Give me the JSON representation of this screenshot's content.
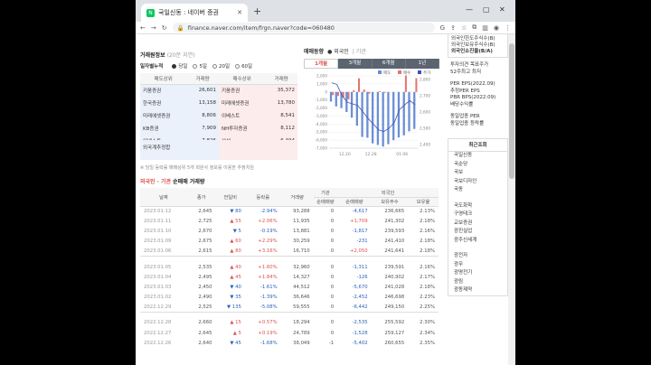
{
  "browser": {
    "tab_title": "국일신동 : 네이버 증권",
    "tab_favicon": "N",
    "url": "finance.naver.com/item/frgn.naver?code=060480",
    "win_minimize": "—",
    "win_maximize": "▢",
    "win_close": "✕"
  },
  "trade_info": {
    "title": "거래원정보",
    "subtitle": "(20분 지연)",
    "period_label": "일자별누적",
    "periods": [
      "당일",
      "5일",
      "20일",
      "60일"
    ],
    "buy_header": "매도상위",
    "qty_header": "거래량",
    "sell_header": "매수상위",
    "qty_header2": "거래량",
    "rows": [
      {
        "sell_broker": "키움증권",
        "sell_qty": "26,601",
        "buy_broker": "키움증권",
        "buy_qty": "35,372"
      },
      {
        "sell_broker": "한국증권",
        "sell_qty": "13,158",
        "buy_broker": "미래에셋증권",
        "buy_qty": "13,780"
      },
      {
        "sell_broker": "미래에셋증권",
        "sell_qty": "8,806",
        "buy_broker": "이베스트",
        "buy_qty": "8,541"
      },
      {
        "sell_broker": "KB증권",
        "sell_qty": "7,909",
        "buy_broker": "NH투자증권",
        "buy_qty": "8,112"
      },
      {
        "sell_broker": "이베스트",
        "sell_qty": "7,826",
        "buy_broker": "삼성",
        "buy_qty": "6,494"
      }
    ],
    "foreign_label": "외국계추정합",
    "note": "※ 당일 등락률 매매상위 5개 회원사 정보를 이용한 추정치임"
  },
  "trend_chart": {
    "title": "매매동향",
    "legend_foreign": "외국인",
    "legend_inst": "기관",
    "tabs": [
      "1개월",
      "3개월",
      "6개월",
      "1년"
    ],
    "selected_tab": 0,
    "series_labels": [
      "매도",
      "매수",
      "주가"
    ]
  },
  "chart_data": {
    "type": "bar",
    "title": "",
    "x_ticks": [
      "12.20",
      "12.28",
      "01.06"
    ],
    "y_left_ticks": [
      "2,000",
      "1,000",
      "0",
      "-1,000",
      "-2,000",
      "-3,000",
      "-4,000",
      "-5,000",
      "-6,000",
      "-7,000"
    ],
    "y_right_ticks": [
      "2,800",
      "2,700",
      "2,600",
      "2,500",
      "2,400"
    ],
    "ylim": [
      -7000,
      2000
    ],
    "series": [
      {
        "name": "매도",
        "color": "#6b8fd6",
        "values": [
          -1200,
          -1800,
          -2000,
          -2500,
          -3200,
          -4200,
          -5600,
          -5700,
          -6400,
          -6600,
          -6800,
          -6500,
          -6000,
          -5670,
          -5400,
          -4900,
          -4600
        ]
      },
      {
        "name": "매수",
        "color": "#e57373",
        "values": [
          -400,
          -500,
          -700,
          -900,
          200,
          1700,
          300,
          -200,
          0,
          100,
          -100,
          0,
          0,
          0,
          2050,
          0,
          1709
        ]
      },
      {
        "name": "주가",
        "color": "#3f51b5",
        "price_values": [
          2780,
          2770,
          2700,
          2660,
          2650,
          2640,
          2600,
          2560,
          2525,
          2490,
          2480,
          2500,
          2535,
          2615,
          2645,
          2670,
          2645
        ]
      }
    ]
  },
  "summary": {
    "title_a": "외국인",
    "title_b": " · 기관",
    "title_c": " 순매매 거래량",
    "headers": {
      "date": "날짜",
      "close": "종가",
      "change": "전일비",
      "rate": "등락률",
      "volume": "거래량",
      "inst_group": "기관",
      "inst_net": "순매매량",
      "foreign_group": "외국인",
      "foreign_net": "순매매량",
      "foreign_hold": "보유주수",
      "foreign_ratio": "보유율"
    },
    "groups": [
      [
        {
          "date": "2023.01.12",
          "close": "2,645",
          "dir": "down",
          "change": "80",
          "rate": "-2.94%",
          "volume": "93,288",
          "inst": "0",
          "fnet": "-4,617",
          "hold": "236,665",
          "ratio": "2.13%"
        },
        {
          "date": "2023.01.11",
          "close": "2,725",
          "dir": "up",
          "change": "55",
          "rate": "+2.06%",
          "volume": "11,935",
          "inst": "0",
          "fnet": "+1,709",
          "hold": "241,302",
          "ratio": "2.18%"
        },
        {
          "date": "2023.01.10",
          "close": "2,670",
          "dir": "down",
          "change": "5",
          "rate": "-0.19%",
          "volume": "13,881",
          "inst": "0",
          "fnet": "-1,817",
          "hold": "239,593",
          "ratio": "2.16%"
        },
        {
          "date": "2023.01.09",
          "close": "2,675",
          "dir": "up",
          "change": "60",
          "rate": "+2.29%",
          "volume": "30,259",
          "inst": "0",
          "fnet": "-231",
          "hold": "241,410",
          "ratio": "2.18%"
        },
        {
          "date": "2023.01.06",
          "close": "2,615",
          "dir": "up",
          "change": "80",
          "rate": "+3.16%",
          "volume": "16,710",
          "inst": "0",
          "fnet": "+2,050",
          "hold": "241,641",
          "ratio": "2.18%"
        }
      ],
      [
        {
          "date": "2023.01.05",
          "close": "2,535",
          "dir": "up",
          "change": "40",
          "rate": "+1.60%",
          "volume": "32,960",
          "inst": "0",
          "fnet": "-1,311",
          "hold": "239,591",
          "ratio": "2.16%"
        },
        {
          "date": "2023.01.04",
          "close": "2,495",
          "dir": "up",
          "change": "45",
          "rate": "+1.84%",
          "volume": "14,327",
          "inst": "0",
          "fnet": "-126",
          "hold": "240,902",
          "ratio": "2.17%"
        },
        {
          "date": "2023.01.03",
          "close": "2,450",
          "dir": "down",
          "change": "40",
          "rate": "-1.61%",
          "volume": "44,512",
          "inst": "0",
          "fnet": "-5,670",
          "hold": "241,028",
          "ratio": "2.18%"
        },
        {
          "date": "2023.01.02",
          "close": "2,490",
          "dir": "down",
          "change": "35",
          "rate": "-1.39%",
          "volume": "36,646",
          "inst": "0",
          "fnet": "-2,452",
          "hold": "246,698",
          "ratio": "2.23%"
        },
        {
          "date": "2022.12.29",
          "close": "2,525",
          "dir": "down",
          "change": "135",
          "rate": "-5.08%",
          "volume": "59,555",
          "inst": "0",
          "fnet": "-6,442",
          "hold": "249,150",
          "ratio": "2.25%"
        }
      ],
      [
        {
          "date": "2022.12.28",
          "close": "2,660",
          "dir": "up",
          "change": "15",
          "rate": "+0.57%",
          "volume": "18,294",
          "inst": "0",
          "fnet": "-2,535",
          "hold": "255,592",
          "ratio": "2.30%"
        },
        {
          "date": "2022.12.27",
          "close": "2,645",
          "dir": "up",
          "change": "5",
          "rate": "+0.19%",
          "volume": "24,789",
          "inst": "0",
          "fnet": "-1,528",
          "hold": "259,127",
          "ratio": "2.34%"
        },
        {
          "date": "2022.12.26",
          "close": "2,640",
          "dir": "down",
          "change": "45",
          "rate": "-1.68%",
          "volume": "38,049",
          "inst": "-1",
          "fnet": "-5,402",
          "hold": "260,655",
          "ratio": "2.35%"
        }
      ]
    ]
  },
  "sidebar": {
    "top_lines": [
      "외국인한도주식수(B)",
      "외국인보유주식수(B)",
      "외국인소진율(B/A)"
    ],
    "mid_lines": [
      "투자의견  목표주가",
      "52주최고  최저"
    ],
    "per_lines": [
      "PER  EPS(2022.09)",
      "추정PER  EPS",
      "PBR  BPS(2022.09)",
      "배당수익률"
    ],
    "peer_lines": [
      "동일업종 PER",
      "동일업종 등락률"
    ],
    "recent_title": "최근조회",
    "recent_a": [
      "국일신동",
      "국순당",
      "국보",
      "국보디자인",
      "국동"
    ],
    "recent_b": [
      "국도화학",
      "구영테크",
      "교보증권",
      "광진실업",
      "광주신세계"
    ],
    "recent_c": [
      "광전자",
      "광무",
      "광명전기",
      "광림",
      "광동제약"
    ]
  }
}
